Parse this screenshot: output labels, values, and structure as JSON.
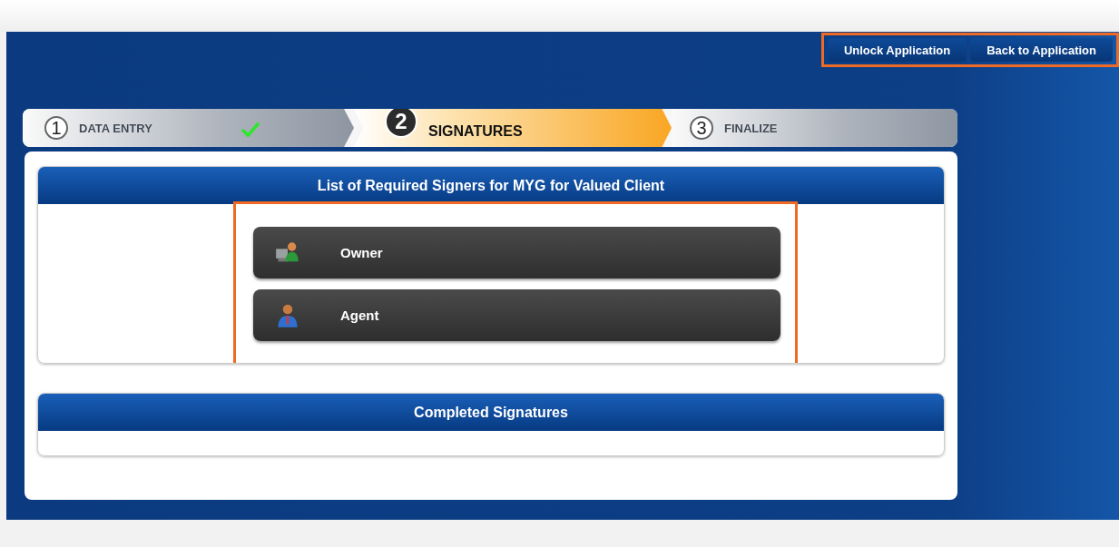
{
  "header_actions": {
    "highlighted": true,
    "buttons": [
      {
        "label": "Unlock Application"
      },
      {
        "label": "Back to Application"
      }
    ]
  },
  "steps": [
    {
      "number": "1",
      "label": "DATA ENTRY",
      "selected": false,
      "completed": true
    },
    {
      "number": "2",
      "label": "SIGNATURES",
      "selected": true,
      "completed": false
    },
    {
      "number": "3",
      "label": "FINALIZE",
      "selected": false,
      "completed": false
    }
  ],
  "required_signers": {
    "title": "List of Required Signers for MYG for Valued Client",
    "highlighted": true,
    "signers": [
      {
        "name": "Owner",
        "kind": "owner"
      },
      {
        "name": "Agent",
        "kind": "agent"
      }
    ]
  },
  "completed_signatures": {
    "title": "Completed Signatures"
  }
}
